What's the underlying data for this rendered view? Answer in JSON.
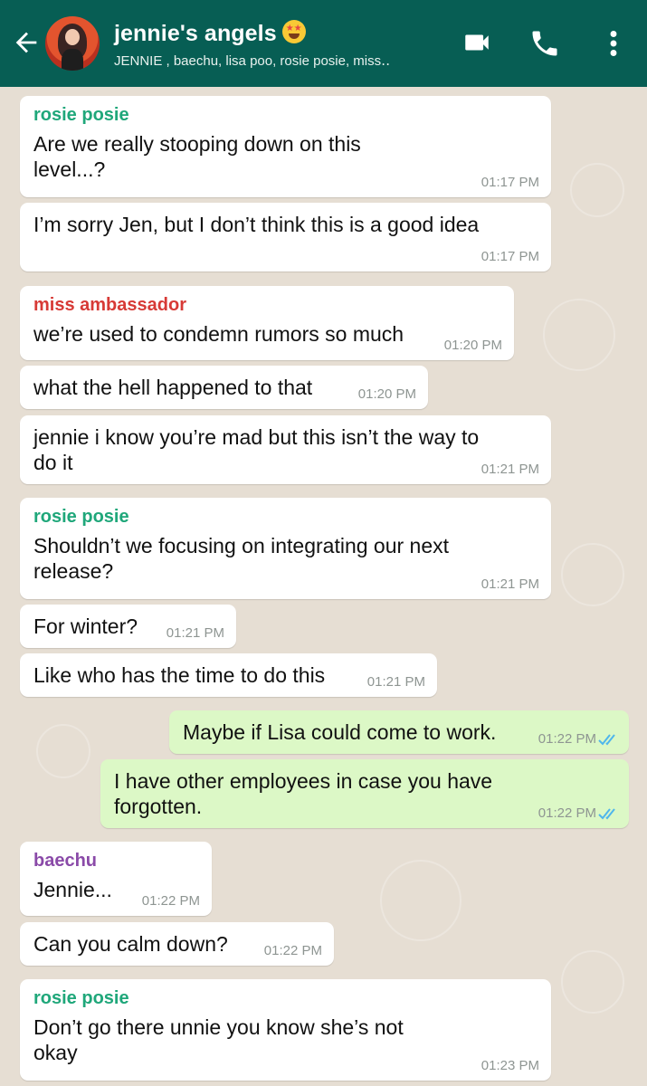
{
  "header": {
    "title": "jennie's angels",
    "subtitle": "JENNIE , baechu, lisa poo, rosie posie, miss‥"
  },
  "colors": {
    "header_bg": "#075e54",
    "chat_bg": "#e6ded3",
    "incoming_bubble": "#ffffff",
    "outgoing_bubble": "#dcf8c6",
    "rosie_name": "#1fa77a",
    "ambassador_name": "#d73a36",
    "baechu_name": "#8a4aa8",
    "read_ticks": "#4fb6ec"
  },
  "icons": {
    "back": "arrow-left-icon",
    "video": "video-camera-icon",
    "call": "phone-icon",
    "menu": "more-vert-icon"
  },
  "messages": [
    {
      "sender": "rosie posie",
      "text": "Are we really stooping down on this level...?",
      "time": "01:17 PM",
      "direction": "in"
    },
    {
      "text": "I’m sorry Jen, but I don’t think this is a good idea",
      "time": "01:17 PM",
      "direction": "in"
    },
    {
      "sender": "miss ambassador",
      "text": "we’re used to condemn rumors so much",
      "time": "01:20 PM",
      "direction": "in"
    },
    {
      "text": "what the hell happened to that",
      "time": "01:20 PM",
      "direction": "in"
    },
    {
      "text": "jennie i know you’re mad but this isn’t the way to do it",
      "time": "01:21 PM",
      "direction": "in"
    },
    {
      "sender": "rosie posie",
      "text": "Shouldn’t we focusing on integrating our next release?",
      "time": "01:21 PM",
      "direction": "in"
    },
    {
      "text": "For winter?",
      "time": "01:21 PM",
      "direction": "in"
    },
    {
      "text": "Like who has the time to do this",
      "time": "01:21 PM",
      "direction": "in"
    },
    {
      "text": "Maybe if Lisa could come to work.",
      "time": "01:22 PM",
      "direction": "out",
      "status": "read"
    },
    {
      "text": "I have other employees in case you have forgotten.",
      "time": "01:22 PM",
      "direction": "out",
      "status": "read"
    },
    {
      "sender": "baechu",
      "text": "Jennie...",
      "time": "01:22 PM",
      "direction": "in"
    },
    {
      "text": "Can you calm down?",
      "time": "01:22 PM",
      "direction": "in"
    },
    {
      "sender": "rosie posie",
      "text": "Don’t go there unnie you know she’s not okay",
      "time": "01:23 PM",
      "direction": "in"
    }
  ]
}
